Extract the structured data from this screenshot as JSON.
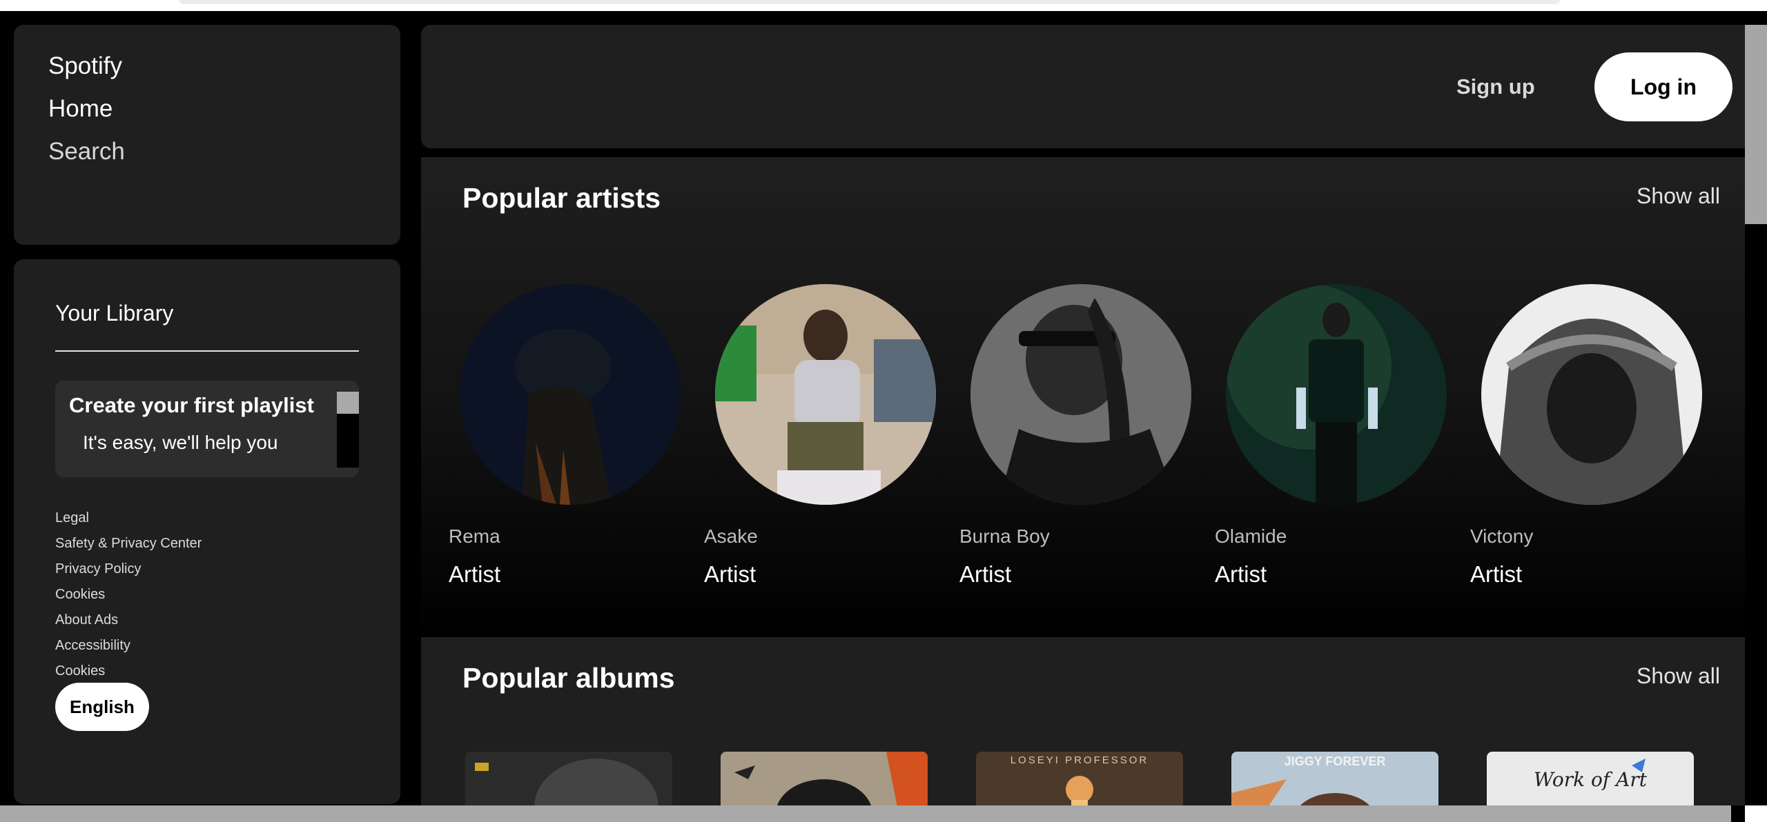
{
  "nav": {
    "spotify": "Spotify",
    "home": "Home",
    "search": "Search"
  },
  "library": {
    "title": "Your Library",
    "create_card": {
      "title": "Create your first playlist",
      "subtitle": "It's easy, we'll help you"
    },
    "footer_links": [
      "Legal",
      "Safety & Privacy Center",
      "Privacy Policy",
      "Cookies",
      "About Ads",
      "Accessibility",
      "Cookies"
    ],
    "language_button": "English"
  },
  "header": {
    "signup_label": "Sign up",
    "login_label": "Log in"
  },
  "popular_artists": {
    "title": "Popular artists",
    "show_all": "Show all",
    "artists": [
      {
        "name": "Rema",
        "type": "Artist"
      },
      {
        "name": "Asake",
        "type": "Artist"
      },
      {
        "name": "Burna Boy",
        "type": "Artist"
      },
      {
        "name": "Olamide",
        "type": "Artist"
      },
      {
        "name": "Victony",
        "type": "Artist"
      }
    ]
  },
  "popular_albums": {
    "title": "Popular albums",
    "show_all": "Show all",
    "album_cover_texts": [
      "",
      "",
      "LOSEYI PROFESSOR",
      "JIGGY FOREVER",
      "Work of Art"
    ]
  },
  "colors": {
    "background": "#000000",
    "panel": "#1f1f1f",
    "text_primary": "#ffffff",
    "text_secondary": "#bdbdbd"
  }
}
